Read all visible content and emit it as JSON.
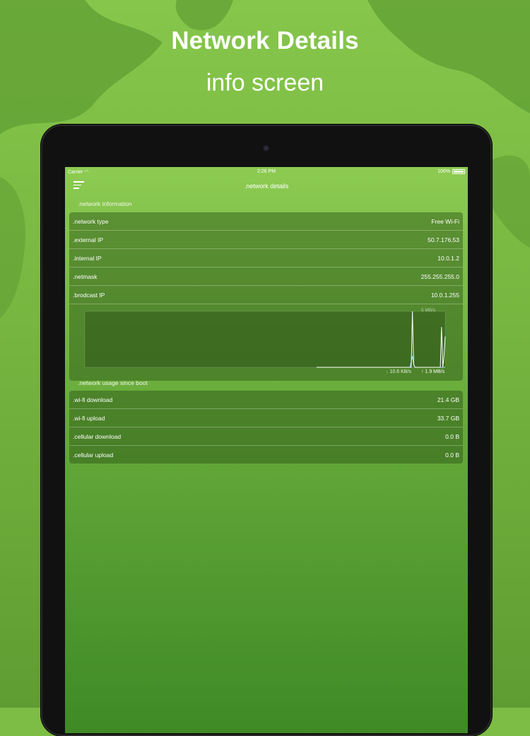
{
  "promo": {
    "headline": "Network Details",
    "subline": "info screen"
  },
  "status_bar": {
    "carrier": "Carrier",
    "time": "2:26 PM",
    "battery": "100%"
  },
  "nav": {
    "title": ".network details",
    "menu_icon": "hamburger-menu-icon"
  },
  "network_information": {
    "header": ".network information",
    "rows": [
      {
        "label": ".network type",
        "value": "Free Wi-Fi"
      },
      {
        "label": ".external IP",
        "value": "50.7.176.53"
      },
      {
        "label": ".internal IP",
        "value": "10.0.1.2"
      },
      {
        "label": ".netmask",
        "value": "255.255.255.0"
      },
      {
        "label": ".brodcast IP",
        "value": "10.0.1.255"
      }
    ]
  },
  "chart_data": {
    "type": "line",
    "scale_label": "5 MB/s",
    "series": [
      {
        "key": "download",
        "color": "#9fd4f0",
        "values": [
          0,
          0,
          0,
          0,
          0,
          0,
          0,
          0,
          0,
          0,
          0,
          0,
          0,
          0,
          0,
          0,
          0,
          0,
          0,
          0,
          0,
          0,
          0,
          0,
          0,
          0,
          0,
          0,
          0,
          0,
          0,
          0,
          0,
          0,
          0,
          0,
          0,
          0,
          0,
          0,
          0,
          0,
          0,
          0,
          0,
          0,
          0,
          0,
          0,
          0,
          0,
          0,
          0,
          0,
          0,
          0,
          0,
          0,
          0,
          0,
          0,
          0,
          0,
          0,
          0,
          0,
          0,
          0,
          0,
          0,
          0,
          0,
          0,
          0,
          0,
          0,
          0,
          0,
          0.1,
          0.2,
          0.05,
          0,
          0,
          0,
          0,
          0,
          0,
          0,
          0,
          0,
          0,
          0,
          0,
          0,
          0,
          0,
          0,
          0,
          0,
          0,
          0,
          0,
          0,
          0,
          0,
          0,
          0
        ]
      },
      {
        "key": "upload",
        "color": "#ffffff",
        "values": [
          0,
          0,
          0,
          0,
          0,
          0,
          0,
          0,
          0,
          0,
          0,
          0,
          0,
          0,
          0,
          0,
          0,
          0,
          0,
          0,
          0,
          0,
          0,
          0,
          0,
          0,
          0,
          0,
          0,
          0,
          0,
          0,
          0,
          0,
          0,
          0,
          0,
          0,
          0,
          0,
          0,
          0,
          0,
          0,
          0,
          0,
          0,
          0,
          0,
          0,
          0,
          0,
          0,
          0,
          0,
          0,
          0,
          0,
          0,
          0,
          0,
          0,
          0,
          0,
          0,
          0,
          0,
          0,
          0,
          0,
          0,
          0,
          0,
          0,
          0,
          0,
          0,
          0,
          0,
          1.0,
          0.05,
          0,
          0,
          0,
          0,
          0,
          0,
          0,
          0,
          0,
          0,
          0,
          0,
          0,
          0,
          0,
          0,
          0,
          0,
          0,
          0,
          0,
          0,
          0.72,
          0,
          0.2,
          0.55
        ]
      }
    ],
    "download_label": "10.6 KB/s",
    "upload_label": "1.9 MB/s"
  },
  "network_usage": {
    "header": ".network usage since boot",
    "rows": [
      {
        "label": ".wi-fi download",
        "value": "21.4 GB"
      },
      {
        "label": ".wi-fi upload",
        "value": "33.7 GB"
      },
      {
        "label": ".cellular download",
        "value": "0.0 B"
      },
      {
        "label": ".cellular upload",
        "value": "0.0 B"
      }
    ]
  }
}
